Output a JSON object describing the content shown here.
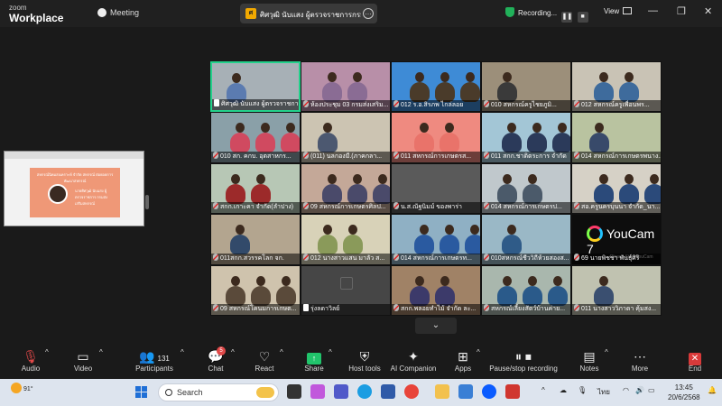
{
  "app": {
    "logo_top": "zoom",
    "logo_bottom": "Workplace",
    "meeting_label": "Meeting"
  },
  "active_speaker": {
    "initial": "ศ",
    "name": "ศิศวุฒิ นับแสง ผู้ตรวจราชการกรมส่งเสริม"
  },
  "recording": {
    "label": "Recording...",
    "pause_icon": "pause-icon",
    "stop_icon": "stop-icon"
  },
  "view": {
    "label": "View"
  },
  "window": {
    "minimize": "—",
    "restore": "❐",
    "close": "✕"
  },
  "shared_slide": {
    "title": "สหกรณ์นิคมสงเคราะห์ จำกัด สหกรณ์ ต่อยอดการพัฒนาสหกรณ์",
    "subtitle": "นายศิศวุฒิ นับแสง ผู้ตรวจราชการ กรมส่งเสริมสหกรณ์"
  },
  "tiles": [
    {
      "label": "ศิศวุฒิ นับแสง ผู้ตรวจราชการ",
      "muted": false,
      "speaking": true,
      "bg": "#a7b0b6",
      "accent": "#5b7bb0"
    },
    {
      "label": "ห้องประชุม 03 กรมส่งเสริม...",
      "muted": true,
      "speaking": false,
      "bg": "#b88fa8",
      "accent": "#8a6c94"
    },
    {
      "label": "012 ร.อ.สิรภพ ไกล่ลอย",
      "muted": true,
      "speaking": false,
      "bg": "#3e8bd6",
      "accent": "#4a3b2a"
    },
    {
      "label": "010 สหกรณ์ครูไชยภูมิ...",
      "muted": true,
      "speaking": false,
      "bg": "#9c8f7a",
      "accent": "#3a3a3a"
    },
    {
      "label": "012 สหกรณ์ครูเพื่อนพร...",
      "muted": true,
      "speaking": false,
      "bg": "#c9c3b5",
      "accent": "#3e6b9c"
    },
    {
      "label": "010 สก. คกบ. อุตสาหกร...",
      "muted": true,
      "speaking": false,
      "bg": "#8aa0a8",
      "accent": "#d04a60"
    },
    {
      "label": "(011) นลกองมี.(ภาคกลา...",
      "muted": true,
      "speaking": false,
      "bg": "#ccc4b2",
      "accent": "#4c5870"
    },
    {
      "label": "011 สหกรณ์การเกษตรส...",
      "muted": true,
      "speaking": false,
      "bg": "#ef8a80",
      "accent": "#e9736a"
    },
    {
      "label": "011 สกก.ชาติตระการ จำกัด",
      "muted": true,
      "speaking": false,
      "bg": "#a3c6d6",
      "accent": "#2b3a5a"
    },
    {
      "label": "014 สหกรณ์การเกษตรพนาง...",
      "muted": true,
      "speaking": false,
      "bg": "#b9c3a0",
      "accent": "#384a6a"
    },
    {
      "label": "สกก.เกาะคา จำกัด(ลำปาง)",
      "muted": true,
      "speaking": false,
      "bg": "#b7c7b5",
      "accent": "#9c2a2a"
    },
    {
      "label": "09 สหกรณ์การเกษตรศิลป...",
      "muted": true,
      "speaking": false,
      "bg": "#c4a898",
      "accent": "#4a4a6a"
    },
    {
      "label": "น.ส.ณัฐนิมม์ ของพาร่า",
      "muted": true,
      "speaking": false,
      "bg": "#5a5a5a",
      "accent": "#2a2a2a"
    },
    {
      "label": "014 สหกรณ์การเกษตรป...",
      "muted": true,
      "speaking": false,
      "bg": "#c0c8cc",
      "accent": "#4b5a6a"
    },
    {
      "label": "สอ.ครูนครบุนนา จำกัด_นา...",
      "muted": true,
      "speaking": false,
      "bg": "#d6d1c6",
      "accent": "#2b4a7a"
    },
    {
      "label": "011สกก.สวรรคโลก จก.",
      "muted": true,
      "speaking": false,
      "bg": "#b3a58f",
      "accent": "#324a6a"
    },
    {
      "label": "012 นางสาวแสน มาลัว ส...",
      "muted": true,
      "speaking": false,
      "bg": "#d8d2b8",
      "accent": "#8a9a5a"
    },
    {
      "label": "014 สหกรณ์การเกษตรท...",
      "muted": true,
      "speaking": false,
      "bg": "#8fb0c4",
      "accent": "#2a5aa0"
    },
    {
      "label": "010สหกรณ์ชีววิถีห้วยสองส...",
      "muted": true,
      "speaking": false,
      "bg": "#9ab8c6",
      "accent": "#2f5b88"
    },
    {
      "label": "69 นายพิชชา พันธุ์ศิริ",
      "muted": true,
      "speaking": false,
      "bg": "#0d0d0d",
      "accent": "#0d0d0d"
    },
    {
      "label": "09 สหกรณ์โคนมการเกษต...",
      "muted": true,
      "speaking": false,
      "bg": "#cfc3ad",
      "accent": "#5a4a3a"
    },
    {
      "label": "รุ่งลดาวิลย์",
      "muted": false,
      "speaking": false,
      "bg": "#464646",
      "accent": "#464646"
    },
    {
      "label": "สกก.พลอยทำไม้ จำกัด ละ...",
      "muted": true,
      "speaking": false,
      "bg": "#a08266",
      "accent": "#3c3a6a"
    },
    {
      "label": "สหกรณ์เลี้ยงสัตว์บ้านค่าย...",
      "muted": true,
      "speaking": false,
      "bg": "#a9b7ad",
      "accent": "#2a5a8a"
    },
    {
      "label": "011 นางสาววิภาดา คุ้มสง...",
      "muted": true,
      "speaking": false,
      "bg": "#c0c2b0",
      "accent": "#3a4f70"
    }
  ],
  "youcam": {
    "title": "YouCam 7",
    "sub": "Please Start YouCam"
  },
  "toolbar": {
    "audio": "Audio",
    "video": "Video",
    "participants": "Participants",
    "participant_count": "131",
    "chat": "Chat",
    "chat_badge": "5",
    "react": "React",
    "share": "Share",
    "host_tools": "Host tools",
    "ai_companion": "AI Companion",
    "apps": "Apps",
    "pause_stop_recording": "Pause/stop recording",
    "notes": "Notes",
    "more": "More",
    "end": "End"
  },
  "taskbar": {
    "temperature": "91°",
    "search_placeholder": "Search",
    "language": "ไทย",
    "time": "13:45",
    "date": "20/6/2568"
  }
}
